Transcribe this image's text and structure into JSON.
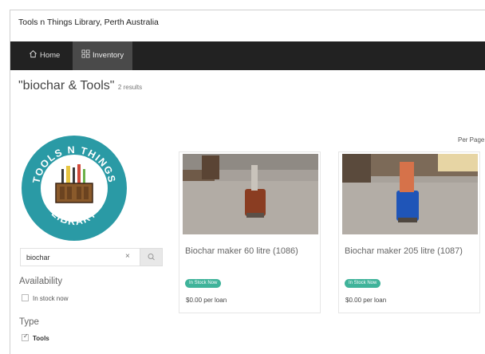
{
  "header": {
    "site_title": "Tools n Things Library, Perth Australia"
  },
  "nav": {
    "items": [
      {
        "label": "Home",
        "icon": "home-icon",
        "active": false
      },
      {
        "label": "Inventory",
        "icon": "grid-icon",
        "active": true
      }
    ]
  },
  "results": {
    "query_heading": "\"biochar & Tools\"",
    "count_text": "2 results",
    "per_page_label": "Per Page"
  },
  "logo": {
    "text_top": "TOOLS N THINGS",
    "text_bottom": "LIBRARY",
    "colors": {
      "ring": "#2a9aa5",
      "inner": "#ffffff",
      "box": "#8a5a2b"
    }
  },
  "search": {
    "value": "biochar",
    "clear_symbol": "×",
    "button_icon": "search-icon"
  },
  "filters": {
    "availability": {
      "title": "Availability",
      "options": [
        {
          "label": "In stock now",
          "checked": false
        }
      ]
    },
    "type": {
      "title": "Type",
      "options": [
        {
          "label": "Tools",
          "checked": true
        }
      ]
    }
  },
  "items": [
    {
      "title": "Biochar maker 60 litre (1086)",
      "status": "In Stock Now",
      "price": "$0.00 per loan",
      "drum_color": "#8a3d22"
    },
    {
      "title": "Biochar maker 205 litre (1087)",
      "status": "In Stock Now",
      "price": "$0.00 per loan",
      "drum_color": "#1f55b8"
    }
  ],
  "colors": {
    "navbar": "#222222",
    "nav_active": "#4a4a4a",
    "badge": "#3fb39a"
  }
}
